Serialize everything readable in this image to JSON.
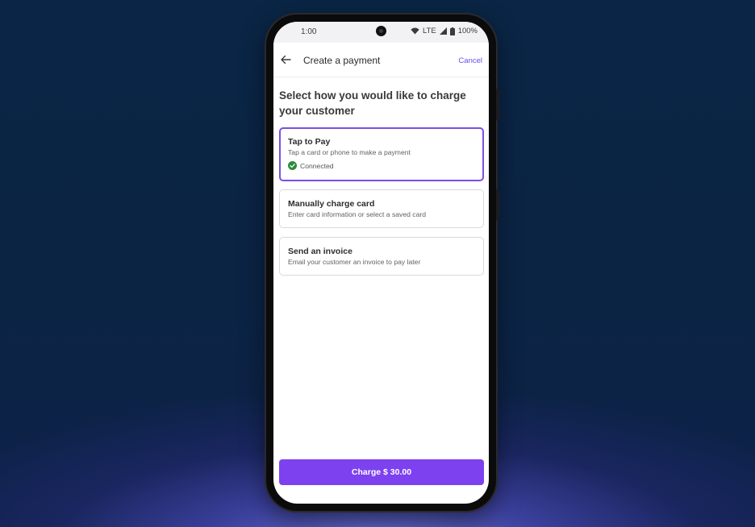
{
  "status_bar": {
    "time": "1:00",
    "network": "LTE",
    "battery": "100%"
  },
  "app_bar": {
    "title": "Create a payment",
    "cancel_label": "Cancel"
  },
  "headline": "Select how you would like to charge your customer",
  "options": [
    {
      "title": "Tap to Pay",
      "description": "Tap a card or phone to make a payment",
      "status": "Connected",
      "selected": true
    },
    {
      "title": "Manually charge card",
      "description": "Enter card information or select a saved card",
      "selected": false
    },
    {
      "title": "Send an invoice",
      "description": "Email your customer an invoice to pay later",
      "selected": false
    }
  ],
  "charge_button_label": "Charge $ 30.00",
  "colors": {
    "accent": "#7b4ee4",
    "button": "#7d41f0",
    "connected": "#2e8b3d"
  },
  "icons": {
    "back": "arrow-left-icon",
    "connected": "check-circle-icon",
    "wifi": "wifi-icon",
    "signal": "signal-icon",
    "battery": "battery-icon"
  }
}
